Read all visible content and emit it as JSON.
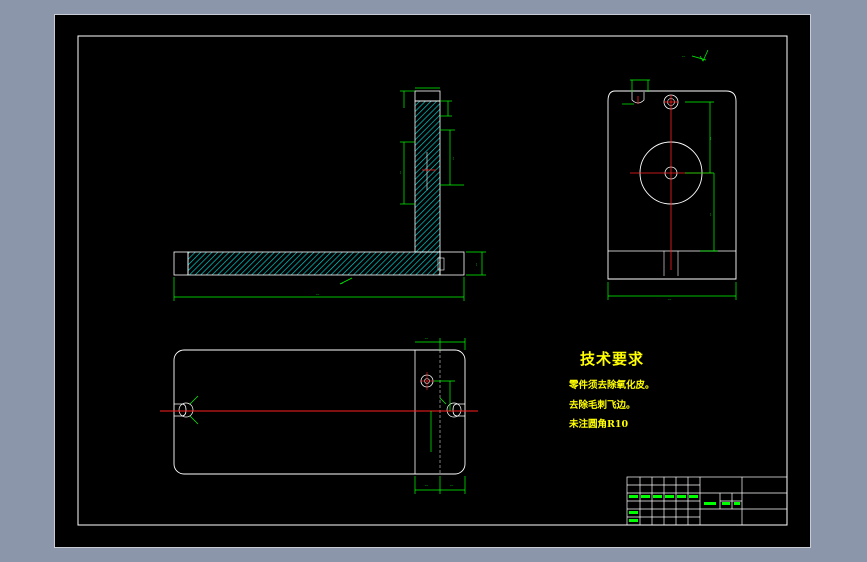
{
  "tech_requirements": {
    "title": "技术要求",
    "lines": [
      "零件须去除氧化皮。",
      "去除毛刺飞边。",
      "未注圆角R10"
    ]
  },
  "colors": {
    "background": "#000000",
    "outline": "#ffffff",
    "dimension": "#00ff00",
    "centerline": "#ff0000",
    "hatch": "#00ffff",
    "text": "#ffff00",
    "surround": "#8c96aa"
  }
}
